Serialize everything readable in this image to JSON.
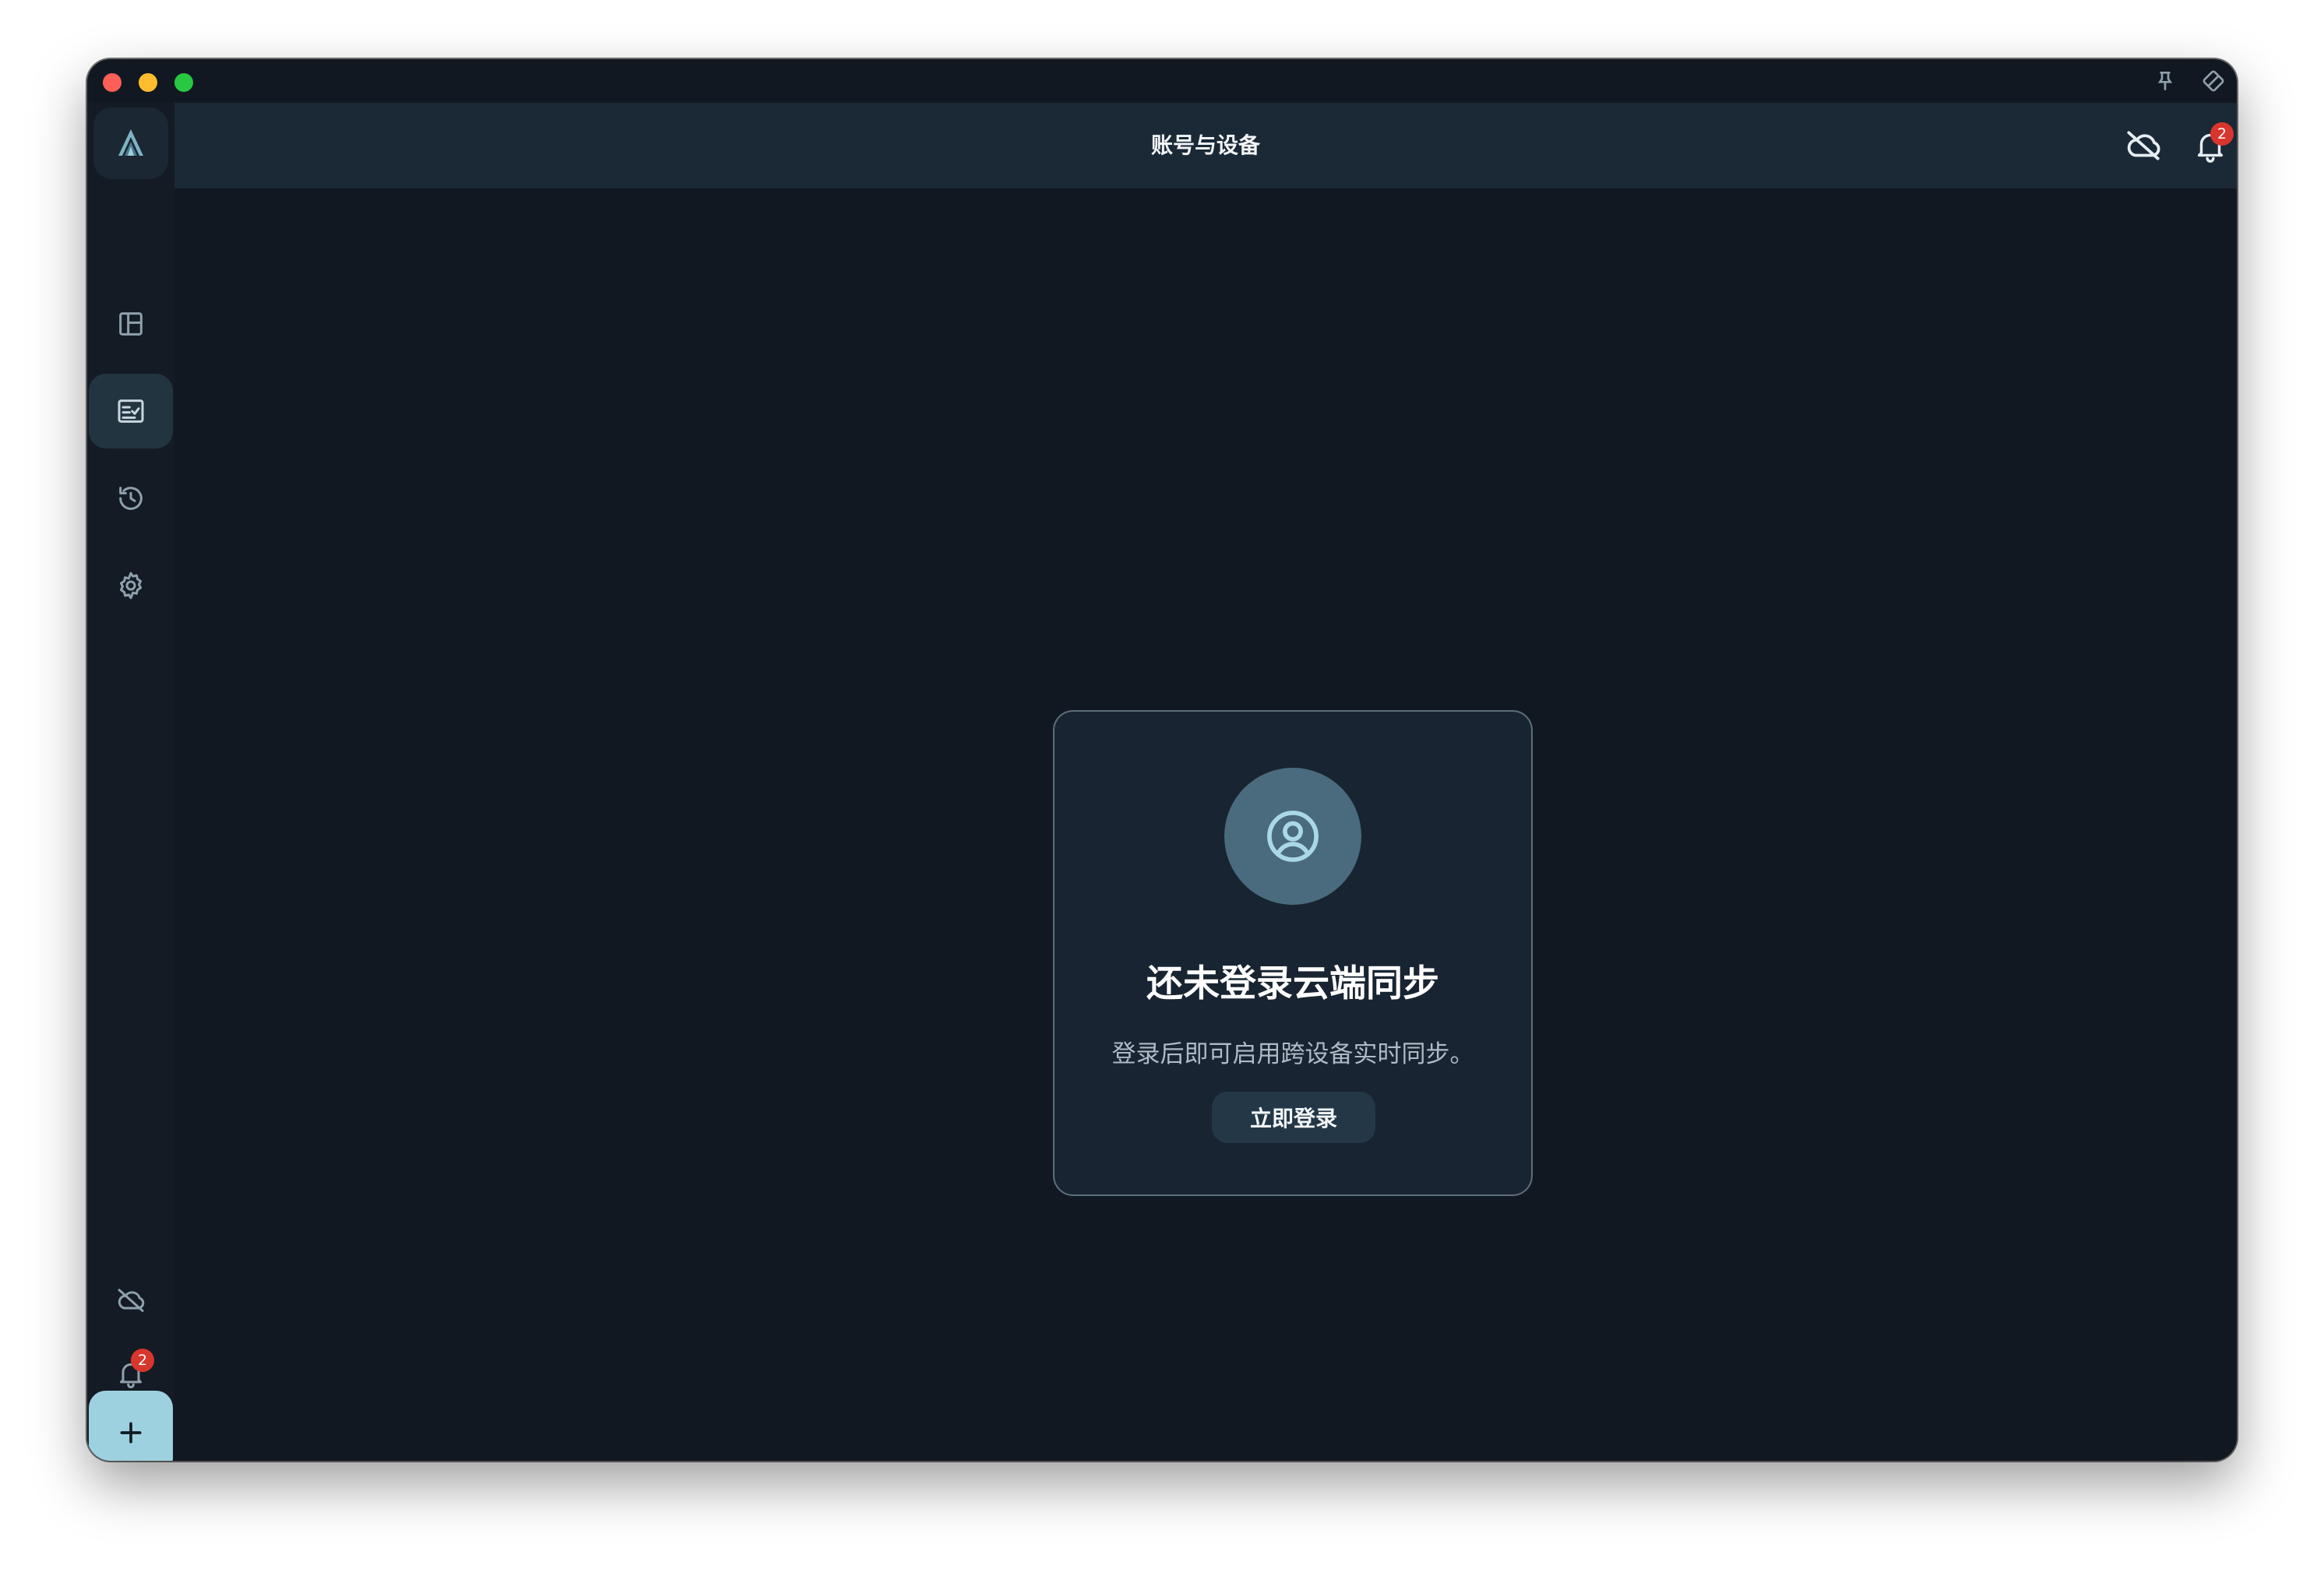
{
  "header": {
    "title": "账号与设备"
  },
  "sidebar": {
    "items": [
      {
        "name": "dashboard",
        "icon": "layout-icon"
      },
      {
        "name": "tasks",
        "icon": "task-list-icon",
        "active": true
      },
      {
        "name": "history",
        "icon": "history-icon"
      },
      {
        "name": "settings",
        "icon": "gear-icon"
      }
    ],
    "notification_count": "2"
  },
  "topbar": {
    "notification_count": "2"
  },
  "card": {
    "title": "还未登录云端同步",
    "description": "登录后即可启用跨设备实时同步。",
    "login_label": "立即登录"
  },
  "colors": {
    "background": "#111821",
    "topbar": "#1b2835",
    "accent": "#9ed1df",
    "badge": "#d8362d"
  }
}
